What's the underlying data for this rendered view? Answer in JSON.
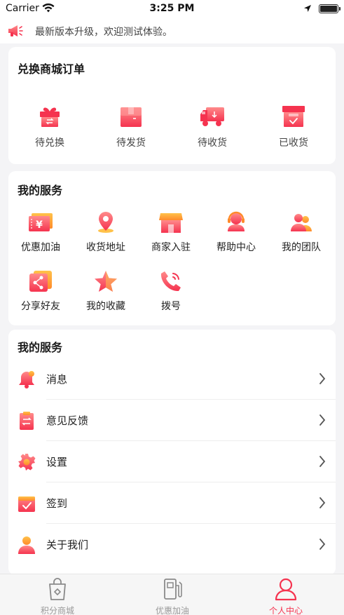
{
  "status_bar": {
    "carrier": "Carrier",
    "time": "3:25 PM"
  },
  "notice": {
    "text": "最新版本升级，欢迎测试体验。"
  },
  "orders": {
    "title": "兑换商城订单",
    "items": [
      {
        "label": "待兑换",
        "icon": "gift-icon"
      },
      {
        "label": "待发货",
        "icon": "package-icon"
      },
      {
        "label": "待收货",
        "icon": "truck-icon"
      },
      {
        "label": "已收货",
        "icon": "box-check-icon"
      }
    ]
  },
  "services": {
    "title": "我的服务",
    "items": [
      {
        "label": "优惠加油",
        "icon": "fuel-coupon-icon"
      },
      {
        "label": "收货地址",
        "icon": "location-pin-icon"
      },
      {
        "label": "商家入驻",
        "icon": "shop-icon"
      },
      {
        "label": "帮助中心",
        "icon": "headset-icon"
      },
      {
        "label": "我的团队",
        "icon": "team-icon"
      },
      {
        "label": "分享好友",
        "icon": "share-icon"
      },
      {
        "label": "我的收藏",
        "icon": "star-icon"
      },
      {
        "label": "拨号",
        "icon": "phone-icon"
      }
    ]
  },
  "list": {
    "title": "我的服务",
    "items": [
      {
        "label": "消息",
        "icon": "bell-icon"
      },
      {
        "label": "意见反馈",
        "icon": "feedback-icon"
      },
      {
        "label": "设置",
        "icon": "gear-icon"
      },
      {
        "label": "签到",
        "icon": "calendar-check-icon"
      },
      {
        "label": "关于我们",
        "icon": "person-icon"
      }
    ]
  },
  "tabbar": {
    "items": [
      {
        "label": "积分商城",
        "icon": "shopping-bag-icon",
        "active": false
      },
      {
        "label": "优惠加油",
        "icon": "gas-station-icon",
        "active": false
      },
      {
        "label": "个人中心",
        "icon": "profile-icon",
        "active": true
      }
    ]
  },
  "colors": {
    "accent": "#f5334f",
    "accent_light": "#ff8a8a",
    "background": "#f4f4f6"
  }
}
